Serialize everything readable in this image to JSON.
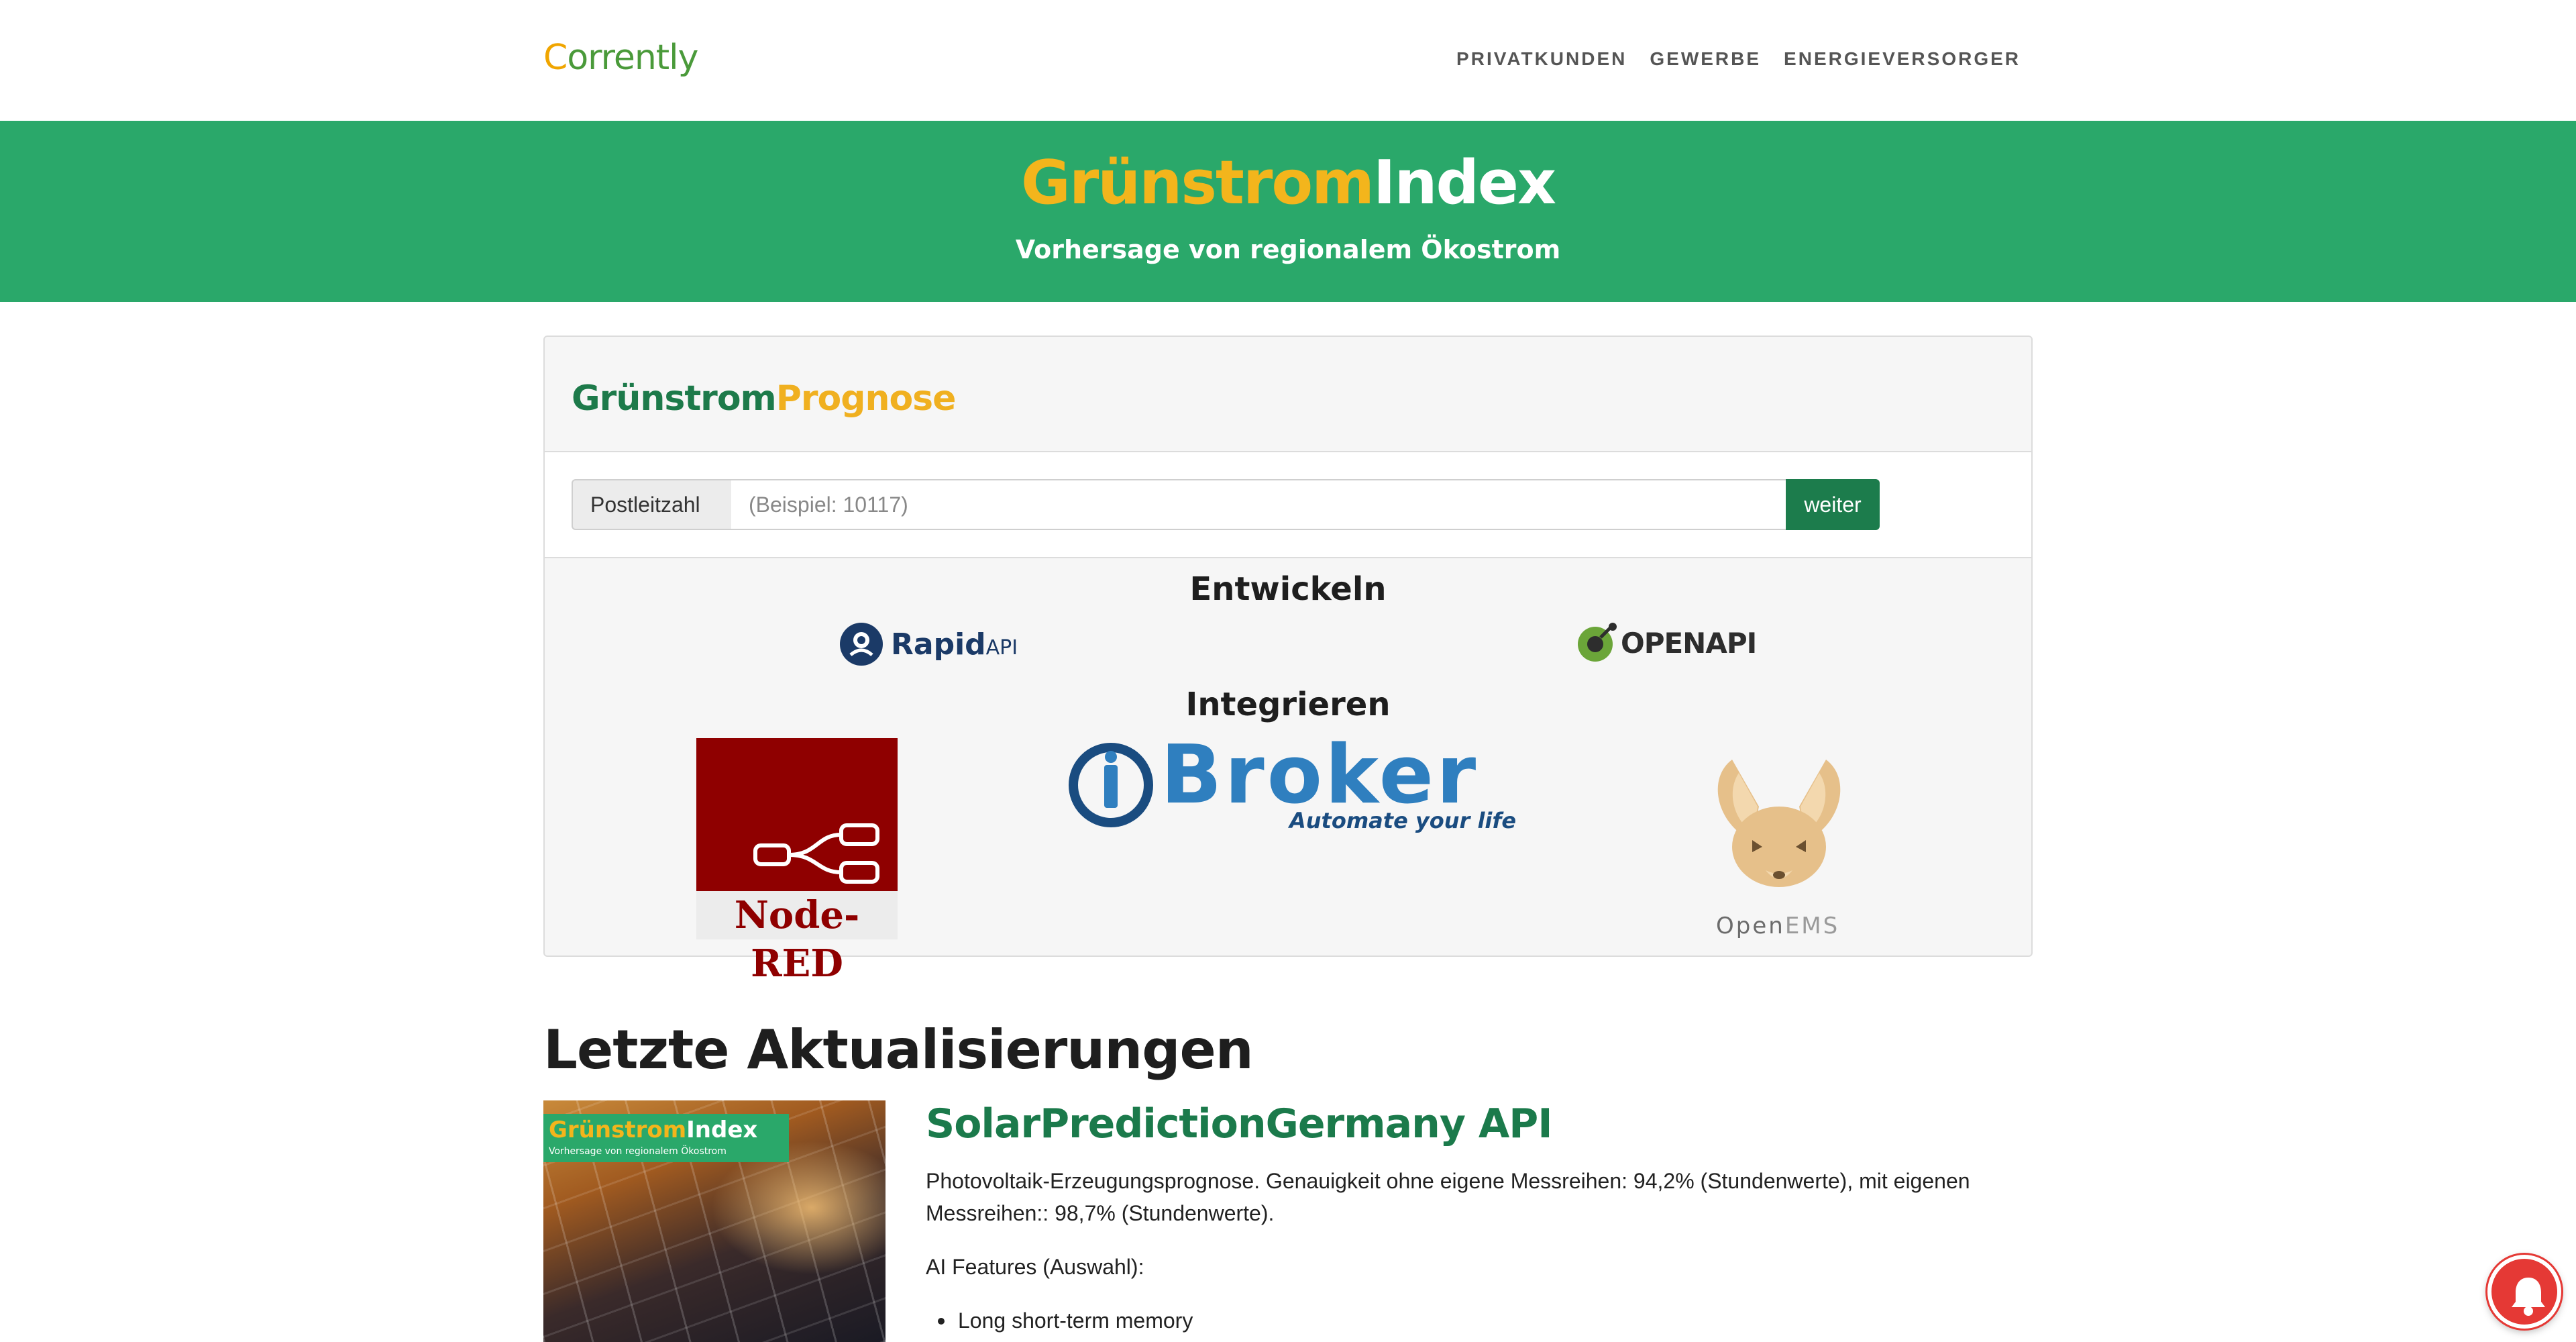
{
  "navbar": {
    "brand_first": "C",
    "brand_rest": "orrently",
    "links": [
      "PRIVATKUNDEN",
      "GEWERBE",
      "ENERGIEVERSORGER"
    ]
  },
  "hero": {
    "title_part1": "Grünstrom",
    "title_part2": "Index",
    "subtitle": "Vorhersage von regionalem Ökostrom"
  },
  "card": {
    "title_part1": "Grünstrom",
    "title_part2": "Prognose",
    "form": {
      "addon_label": "Postleitzahl",
      "zip_placeholder": "(Beispiel: 10117)",
      "submit_label": "weiter"
    },
    "develop_heading": "Entwickeln",
    "integrate_heading": "Integrieren",
    "logos": {
      "rapidapi_main": "Rapid",
      "rapidapi_suffix": "API",
      "openapi": "OPENAPI",
      "nodered": "Node-RED",
      "iobroker": "Broker",
      "iobroker_tag": "Automate your life",
      "openems_main": "Open",
      "openems_suffix": "EMS"
    }
  },
  "updates": {
    "heading": "Letzte Aktualisierungen",
    "thumb": {
      "title_part1": "Grünstrom",
      "title_part2": "Index",
      "subtitle": "Vorhersage von regionalem Ökostrom"
    },
    "post": {
      "title": "SolarPredictionGermany API",
      "paragraph": "Photovoltaik-Erzeugungsprognose. Genauigkeit ohne eigene Messreihen: 94,2% (Stundenwerte), mit eigenen Messreihen:: 98,7% (Stundenwerte).",
      "features_label": "AI Features (Auswahl):",
      "features": [
        "Long short-term memory"
      ]
    }
  },
  "colors": {
    "hero_green": "#2aa86a",
    "accent_yellow": "#f3b51c",
    "dark_green": "#1b7a4b",
    "notification_red": "#e53935"
  },
  "icons": [
    "bell-icon",
    "rapidapi-logo",
    "openapi-logo",
    "nodered-logo",
    "iobroker-logo",
    "openems-logo"
  ]
}
